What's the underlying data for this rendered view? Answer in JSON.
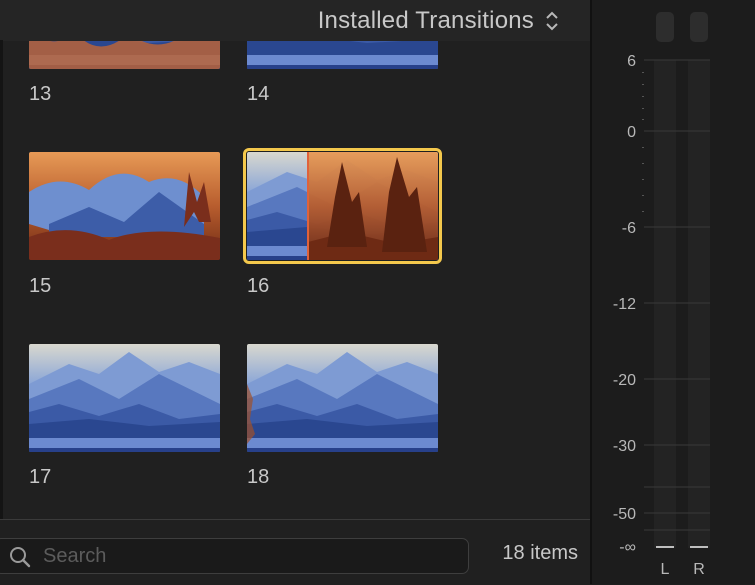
{
  "browser": {
    "title": "Installed Transitions",
    "items": [
      {
        "label": "13",
        "style": "mountains-flames"
      },
      {
        "label": "14",
        "style": "mountains-blue"
      },
      {
        "label": "15",
        "style": "flames"
      },
      {
        "label": "16",
        "style": "split",
        "selected": true
      },
      {
        "label": "17",
        "style": "mountains-blue"
      },
      {
        "label": "18",
        "style": "mountains-burn"
      }
    ],
    "selected_color": "#f4c84c"
  },
  "search": {
    "placeholder": "Search",
    "value": ""
  },
  "status": {
    "items_count": "18 items"
  },
  "meter": {
    "scale": [
      "6",
      "0",
      "-6",
      "-12",
      "-20",
      "-30",
      "-50",
      "-∞"
    ],
    "channels": [
      "L",
      "R"
    ]
  },
  "icons": {
    "search": "search-icon",
    "header_chevron": "up-down-chevron-icon"
  }
}
